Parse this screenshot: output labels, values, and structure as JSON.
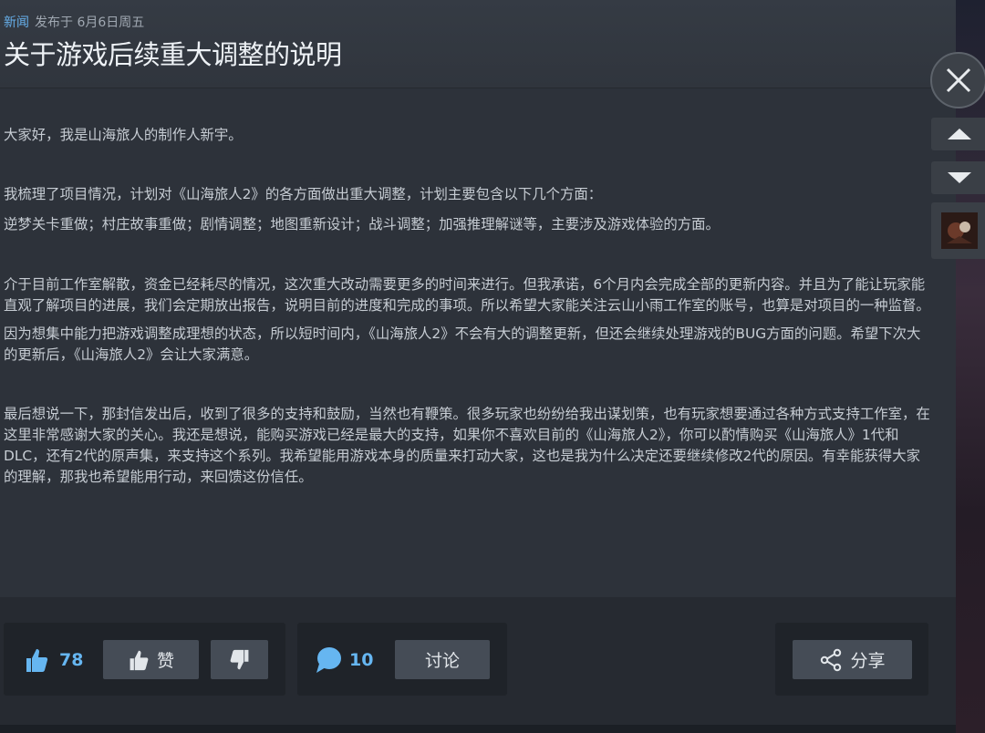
{
  "header": {
    "category": "新闻",
    "posted": "发布于 6月6日周五",
    "title": "关于游戏后续重大调整的说明"
  },
  "body": {
    "p1": "大家好，我是山海旅人的制作人新宇。",
    "p2": "我梳理了项目情况，计划对《山海旅人2》的各方面做出重大调整，计划主要包含以下几个方面：",
    "p3": "逆梦关卡重做；村庄故事重做；剧情调整；地图重新设计；战斗调整；加强推理解谜等，主要涉及游戏体验的方面。",
    "p4": "介于目前工作室解散，资金已经耗尽的情况，这次重大改动需要更多的时间来进行。但我承诺，6个月内会完成全部的更新内容。并且为了能让玩家能直观了解项目的进展，我们会定期放出报告，说明目前的进度和完成的事项。所以希望大家能关注云山小雨工作室的账号，也算是对项目的一种监督。",
    "p5": "因为想集中能力把游戏调整成理想的状态，所以短时间内，《山海旅人2》不会有大的调整更新，但还会继续处理游戏的BUG方面的问题。希望下次大的更新后，《山海旅人2》会让大家满意。",
    "p6": "最后想说一下，那封信发出后，收到了很多的支持和鼓励，当然也有鞭策。很多玩家也纷纷给我出谋划策，也有玩家想要通过各种方式支持工作室，在这里非常感谢大家的关心。我还是想说，能购买游戏已经是最大的支持，如果你不喜欢目前的《山海旅人2》，你可以酌情购买《山海旅人》1代和DLC，还有2代的原声集，来支持这个系列。我希望能用游戏本身的质量来打动大家，这也是我为什么决定还要继续修改2代的原因。有幸能获得大家的理解，那我也希望能用行动，来回馈这份信任。"
  },
  "footer": {
    "likes_count": "78",
    "like_label": "赞",
    "comments_count": "10",
    "discuss_label": "讨论",
    "share_label": "分享"
  },
  "colors": {
    "accent": "#66b6f1",
    "category": "#66aee9",
    "panel": "#2d323a",
    "button": "#454c56"
  },
  "icons": [
    "thumbs-up-icon",
    "thumbs-down-icon",
    "comment-icon",
    "share-icon",
    "close-icon",
    "arrow-up-icon",
    "arrow-down-icon"
  ]
}
